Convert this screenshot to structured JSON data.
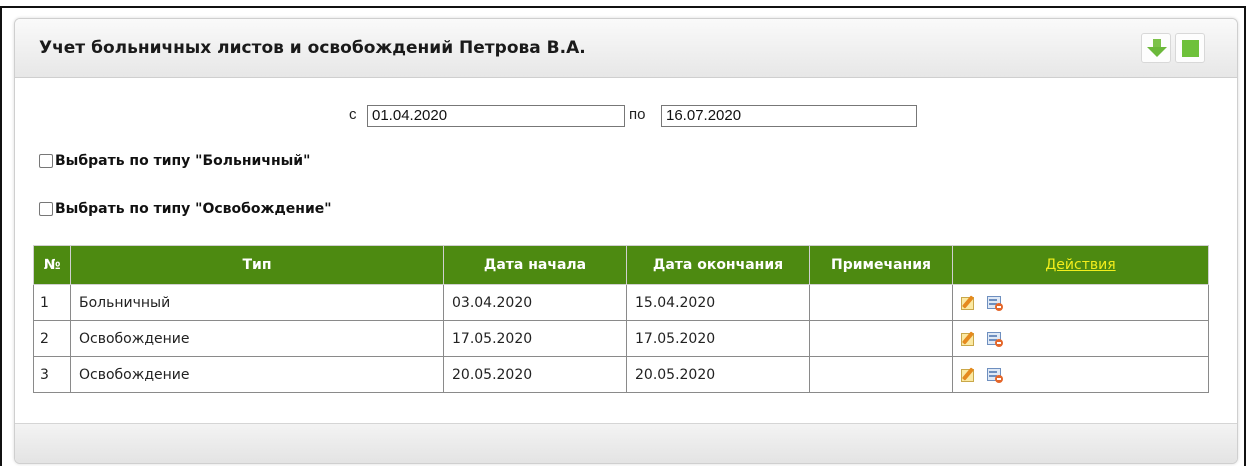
{
  "panel": {
    "title": "Учет больничных листов и освобождений Петрова В.А."
  },
  "header_buttons": {
    "download_icon": "arrow-down-icon",
    "stop_icon": "green-square-icon"
  },
  "filters": {
    "from_label": "с",
    "from_value": "01.04.2020",
    "to_label": "по",
    "to_value": "16.07.2020",
    "checkbox_sick": {
      "label": "Выбрать по типу \"Больничный\"",
      "checked": false
    },
    "checkbox_release": {
      "label": "Выбрать по типу \"Освобождение\"",
      "checked": false
    }
  },
  "table": {
    "columns": [
      "№",
      "Тип",
      "Дата начала",
      "Дата окончания",
      "Примечания",
      "Действия"
    ],
    "rows": [
      {
        "num": "1",
        "type": "Больничный",
        "start": "03.04.2020",
        "end": "15.04.2020",
        "note": ""
      },
      {
        "num": "2",
        "type": "Освобождение",
        "start": "17.05.2020",
        "end": "17.05.2020",
        "note": ""
      },
      {
        "num": "3",
        "type": "Освобождение",
        "start": "20.05.2020",
        "end": "20.05.2020",
        "note": ""
      }
    ],
    "action_icons": [
      "edit-icon",
      "delete-icon"
    ]
  },
  "colors": {
    "header_green": "#4d8a11",
    "link_yellow": "#f2ee1c",
    "button_green": "#6ec13a"
  }
}
